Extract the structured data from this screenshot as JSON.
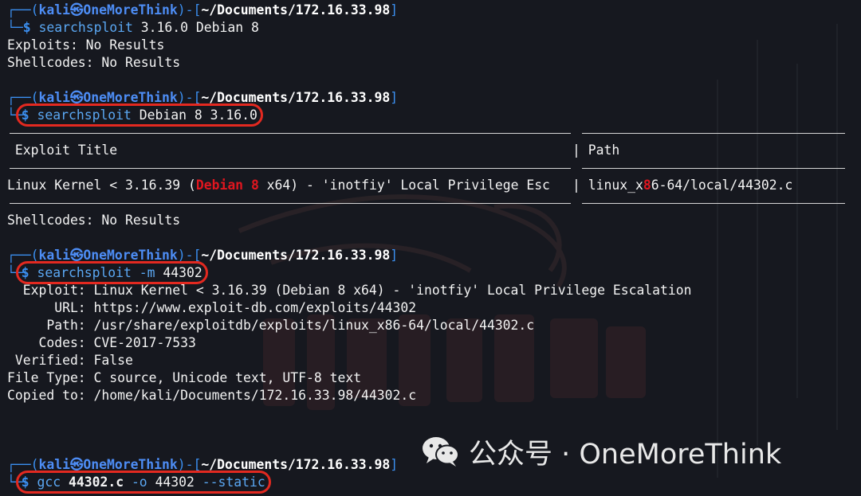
{
  "colors": {
    "background": "#16181f",
    "prompt_blue": "#3b8ff0",
    "highlight_red": "#e32920",
    "red_text": "#e0161f"
  },
  "prompt": {
    "corner_top": "┌──(",
    "user": "kali",
    "at_symbol": "㉿",
    "host": "OneMoreThink",
    "mid": ")-[",
    "dir": "~/Documents/172.16.33.98",
    "close": "]",
    "corner_bottom": "└─",
    "dollar": "$"
  },
  "block1": {
    "cmd": "searchsploit",
    "args": "3.16.0 Debian 8",
    "exploits": "Exploits: No Results",
    "shellcodes": "Shellcodes: No Results"
  },
  "block2": {
    "cmd": "searchsploit",
    "args": "Debian 8 3.16.0",
    "header_title": " Exploit Title",
    "header_sep": "|",
    "header_path": " Path",
    "row_pre": "Linux Kernel < 3.16.39 (",
    "row_red1": "Debian",
    "row_sp": " ",
    "row_red2": "8",
    "row_post": " x64) - 'inotfiy' Local Privilege Esc",
    "row_sep": "|",
    "path_pre": "linux_x",
    "path_red": "8",
    "path_post": "6-64/local/44302.c",
    "shellcodes": "Shellcodes: No Results"
  },
  "block3": {
    "cmd": "searchsploit",
    "flag": "-m",
    "args": "44302",
    "lines": [
      "  Exploit: Linux Kernel < 3.16.39 (Debian 8 x64) - 'inotfiy' Local Privilege Escalation",
      "      URL: https://www.exploit-db.com/exploits/44302",
      "     Path: /usr/share/exploitdb/exploits/linux_x86-64/local/44302.c",
      "    Codes: CVE-2017-7533",
      " Verified: False",
      "File Type: C source, Unicode text, UTF-8 text",
      "Copied to: /home/kali/Documents/172.16.33.98/44302.c"
    ]
  },
  "block4": {
    "cmd": "gcc",
    "file": "44302.c",
    "flag": "-o",
    "out": "44302",
    "static": "--static"
  },
  "watermark": {
    "icon": "wechat-icon",
    "text": "公众号 · OneMoreThink"
  }
}
